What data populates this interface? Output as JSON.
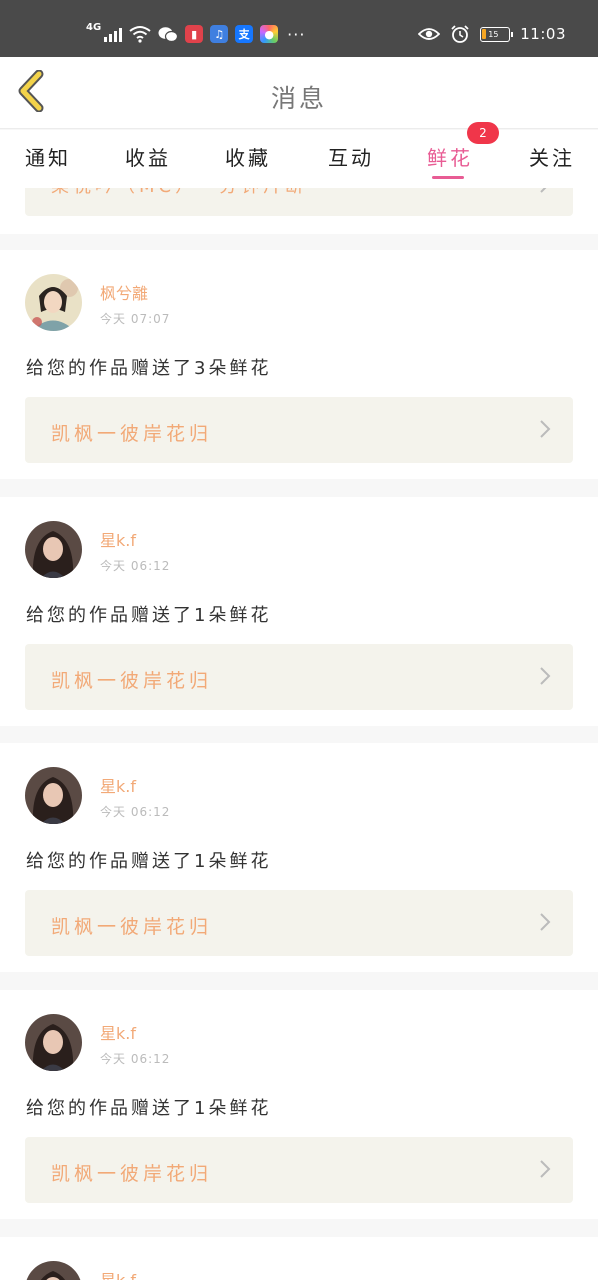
{
  "status_bar": {
    "network": "4G",
    "time": "11:03",
    "battery_level": "15",
    "icons": [
      "signal-icon",
      "wifi-icon",
      "wechat-icon",
      "app-red-icon",
      "music-icon",
      "alipay-icon",
      "photos-icon",
      "eye-icon",
      "alarm-icon",
      "battery-icon"
    ],
    "more": "···"
  },
  "header": {
    "title": "消息"
  },
  "tabs": [
    {
      "label": "通知"
    },
    {
      "label": "收益"
    },
    {
      "label": "收藏"
    },
    {
      "label": "互动"
    },
    {
      "label": "鲜花",
      "active": true,
      "badge": "2"
    },
    {
      "label": "关注"
    }
  ],
  "partial_top_card": {
    "work_title": "梁祝吟（MC）一分钟片断"
  },
  "messages": [
    {
      "user": "枫兮離",
      "time": "今天 07:07",
      "text": "给您的作品赠送了3朵鲜花",
      "work_title": "凯枫一彼岸花归"
    },
    {
      "user": "星k.f",
      "time": "今天 06:12",
      "text": "给您的作品赠送了1朵鲜花",
      "work_title": "凯枫一彼岸花归"
    },
    {
      "user": "星k.f",
      "time": "今天 06:12",
      "text": "给您的作品赠送了1朵鲜花",
      "work_title": "凯枫一彼岸花归"
    },
    {
      "user": "星k.f",
      "time": "今天 06:12",
      "text": "给您的作品赠送了1朵鲜花",
      "work_title": "凯枫一彼岸花归"
    },
    {
      "user": "星k.f"
    }
  ],
  "colors": {
    "accent": "#e85c94",
    "badge": "#f0364a",
    "username": "#f2a977",
    "work_bg": "#f4f3ec",
    "back_arrow": "#f3d34a"
  }
}
